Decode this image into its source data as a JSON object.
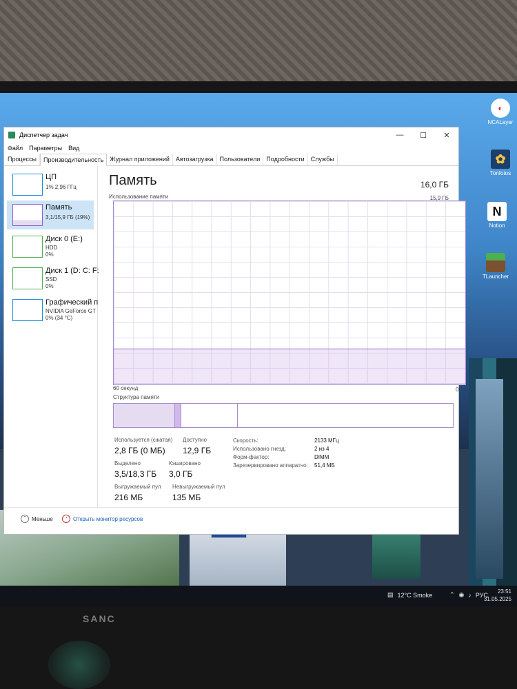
{
  "window": {
    "title": "Диспетчер задач",
    "controls": {
      "minimize": "—",
      "maximize": "☐",
      "close": "✕"
    },
    "menu": [
      "Файл",
      "Параметры",
      "Вид"
    ],
    "tabs": [
      "Процессы",
      "Производительность",
      "Журнал приложений",
      "Автозагрузка",
      "Пользователи",
      "Подробности",
      "Службы"
    ],
    "active_tab": "Производительность"
  },
  "sidebar": {
    "items": [
      {
        "name": "ЦП",
        "line1": "1% 2,96 ГГц",
        "line2": "",
        "color": "#1a8fd6"
      },
      {
        "name": "Память",
        "line1": "3,1/15,9 ГБ (19%)",
        "line2": "",
        "color": "#8c63c6"
      },
      {
        "name": "Диск 0 (E:)",
        "line1": "HDD",
        "line2": "0%",
        "color": "#4caf50"
      },
      {
        "name": "Диск 1 (D: C: F:",
        "line1": "SSD",
        "line2": "0%",
        "color": "#4caf50"
      },
      {
        "name": "Графический п",
        "line1": "NVIDIA GeForce GT",
        "line2": "0% (34 °C)",
        "color": "#1a8fd6"
      }
    ]
  },
  "memory": {
    "title": "Память",
    "capacity": "16,0 ГБ",
    "usage_label": "Использование памяти",
    "usage_max": "15,9 ГБ",
    "time_label": "60 секунд",
    "zero_label": "0",
    "usage_fraction": 0.19,
    "structure_label": "Структура памяти",
    "stats": {
      "in_use": {
        "label": "Используется (сжатая)",
        "value": "2,8 ГБ (0 МБ)"
      },
      "available": {
        "label": "Доступно",
        "value": "12,9 ГБ"
      },
      "committed": {
        "label": "Выделено",
        "value": "3,5/18,3 ГБ"
      },
      "cached": {
        "label": "Кэшировано",
        "value": "3,0 ГБ"
      },
      "paged_pool": {
        "label": "Выгружаемый пул",
        "value": "216 МБ"
      },
      "nonpaged_pool": {
        "label": "Невыгружаемый пул",
        "value": "135 МБ"
      }
    },
    "details": {
      "speed": {
        "label": "Скорость:",
        "value": "2133 МГц"
      },
      "slots": {
        "label": "Использовано гнезд:",
        "value": "2 из 4"
      },
      "form_factor": {
        "label": "Форм-фактор:",
        "value": "DIMM"
      },
      "reserved": {
        "label": "Зарезервировано аппаратно:",
        "value": "51,4 МБ"
      }
    }
  },
  "footer": {
    "less": "Меньше",
    "resource_monitor": "Открыть монитор ресурсов"
  },
  "desktop": {
    "icons": [
      "NCALayer",
      "Tonfotos",
      "Notion",
      "TLauncher"
    ]
  },
  "taskbar": {
    "weather": "12°C Smoke",
    "lang": "РУС",
    "time": "23:51",
    "date": "31.05.2025"
  },
  "monitor": {
    "brand": "SANC"
  }
}
